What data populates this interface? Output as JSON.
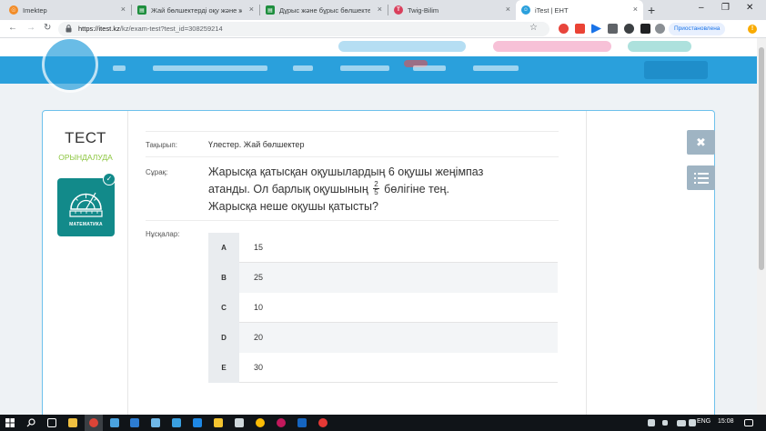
{
  "browser": {
    "tabs": [
      {
        "label": "Imektep",
        "color": "#f28c28",
        "glyph": "☉"
      },
      {
        "label": "Жай бөлшектерді оқу және ж",
        "color": "#1e8e3e",
        "glyph": "▤"
      },
      {
        "label": "Дұрыс және бұрыс бөлшекте",
        "color": "#1e8e3e",
        "glyph": "▤"
      },
      {
        "label": "Twig-Bilim",
        "color": "#d93f5c",
        "glyph": "T"
      },
      {
        "label": "iTest | ЕНТ",
        "color": "#2aa0dc",
        "glyph": "☺"
      }
    ],
    "close_glyph": "×",
    "new_tab_glyph": "+",
    "window": {
      "minimize": "–",
      "maximize": "❐",
      "close": "✕"
    },
    "nav": {
      "back": "←",
      "forward": "→",
      "reload": "↻"
    },
    "url_host": "https://itest.kz",
    "url_path": "/kz/exam-test?test_id=308259214",
    "bookmark_glyph": "☆",
    "profile_label": "Приостановлена",
    "menu_glyph": "!"
  },
  "sidebar": {
    "title": "ТЕСТ",
    "status": "ОРЫНДАЛУДА",
    "subject_label": "МАТЕМАТИКА",
    "check_glyph": "✓",
    "subject_icon": "protractor-icon"
  },
  "question": {
    "topic_label": "Тақырып:",
    "topic_value": "Үлестер. Жай бөлшектер",
    "question_label": "Сұрақ:",
    "text_part1": "Жарысқа қатысқан оқушылардың 6 оқушы жеңімпаз атанды. Ол барлық оқушының",
    "fraction_numerator": "2",
    "fraction_denominator": "5",
    "text_part2": "бөлігіне тең. Жарысқа неше оқушы қатысты?",
    "options_label": "Нұсқалар:",
    "options": [
      {
        "key": "A",
        "value": "15"
      },
      {
        "key": "B",
        "value": "25"
      },
      {
        "key": "C",
        "value": "10"
      },
      {
        "key": "D",
        "value": "20"
      },
      {
        "key": "E",
        "value": "30"
      }
    ]
  },
  "side_buttons": {
    "close_glyph": "✖"
  },
  "taskbar": {
    "language": "ENG",
    "time": "15:08"
  },
  "colors": {
    "accent": "#2aa0dc",
    "status_green": "#8cc63f",
    "subject_teal": "#128a8a"
  }
}
